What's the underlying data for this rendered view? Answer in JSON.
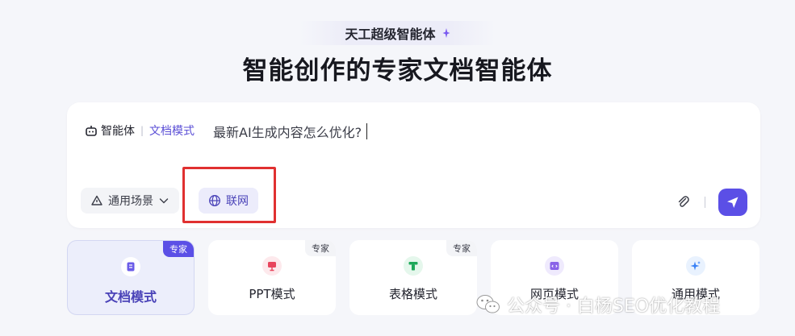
{
  "header": {
    "badge": "天工超级智能体",
    "title": "智能创作的专家文档智能体"
  },
  "input": {
    "agent_label": "智能体",
    "separator": "|",
    "mode_label": "文档模式",
    "prompt_text": "最新AI生成内容怎么优化?"
  },
  "toolbar": {
    "scene_label": "通用场景",
    "network_label": "联网"
  },
  "modes": [
    {
      "label": "文档模式",
      "tag": "专家",
      "icon": "document-icon",
      "active": true
    },
    {
      "label": "PPT模式",
      "tag": "专家",
      "icon": "presentation-icon",
      "active": false
    },
    {
      "label": "表格模式",
      "tag": "专家",
      "icon": "table-icon",
      "active": false
    },
    {
      "label": "网页模式",
      "tag": "",
      "icon": "webpage-icon",
      "active": false
    },
    {
      "label": "通用模式",
      "tag": "",
      "icon": "sparkle-icon",
      "active": false
    }
  ],
  "watermark": {
    "text": "公众号 · 白杨SEO优化教程"
  },
  "colors": {
    "accent": "#5b4fe6",
    "highlight": "#e03030",
    "background": "#f5f6fa"
  }
}
